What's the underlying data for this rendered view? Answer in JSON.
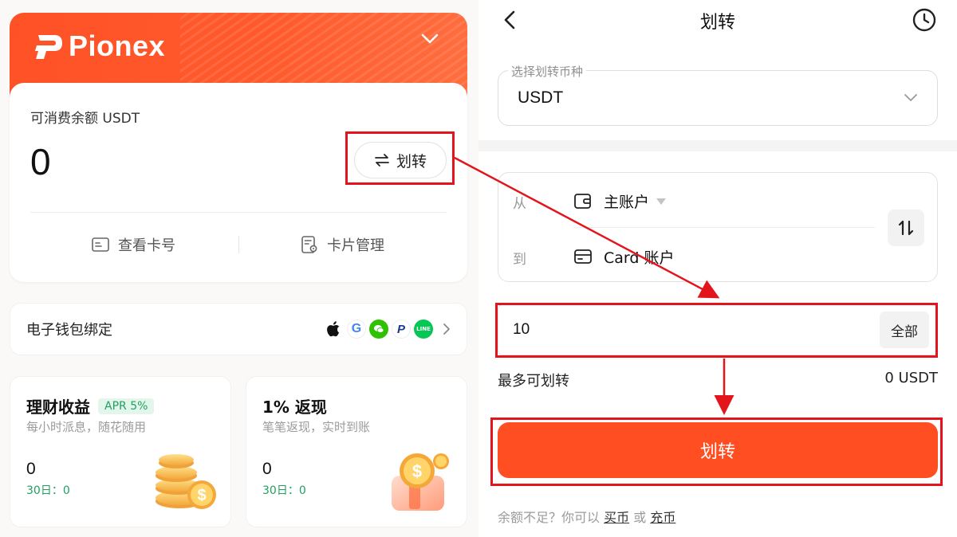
{
  "left_panel": {
    "brand": {
      "name": "Pionex"
    },
    "balance": {
      "label": "可消费余额 USDT",
      "value": "0",
      "transfer_button_label": "划转"
    },
    "actions": [
      {
        "label": "查看卡号",
        "icon": "card-icon"
      },
      {
        "label": "卡片管理",
        "icon": "card-settings-icon"
      }
    ],
    "wallet_binding": {
      "label": "电子钱包绑定",
      "wallets": [
        "apple-pay",
        "google-pay",
        "wechat-pay",
        "paypal",
        "line-pay"
      ]
    },
    "cards": [
      {
        "title": "理财收益",
        "badge": "APR 5%",
        "subtitle": "每小时派息，随花随用",
        "value": "0",
        "thirty_day": "30日：0"
      },
      {
        "title": "1% 返现",
        "subtitle": "笔笔返现，实时到账",
        "value": "0",
        "thirty_day": "30日：0"
      }
    ]
  },
  "right_panel": {
    "title": "划转",
    "coin_select": {
      "legend": "选择划转币种",
      "value": "USDT"
    },
    "from": {
      "label": "从",
      "account": "主账户"
    },
    "to": {
      "label": "到",
      "account": "Card 账户"
    },
    "amount": {
      "value": "10",
      "all_button_label": "全部"
    },
    "max_transfer": {
      "label": "最多可划转",
      "value": "0 USDT"
    },
    "submit_label": "划转",
    "footer": {
      "prefix": "余额不足？你可以",
      "buy_link": "买币",
      "or": "或",
      "deposit_link": "充币"
    }
  },
  "colors": {
    "brand_orange": "#ff5126",
    "button_orange": "#ff4f22",
    "annotation_red": "#e3141b",
    "positive_green": "#22a060"
  }
}
